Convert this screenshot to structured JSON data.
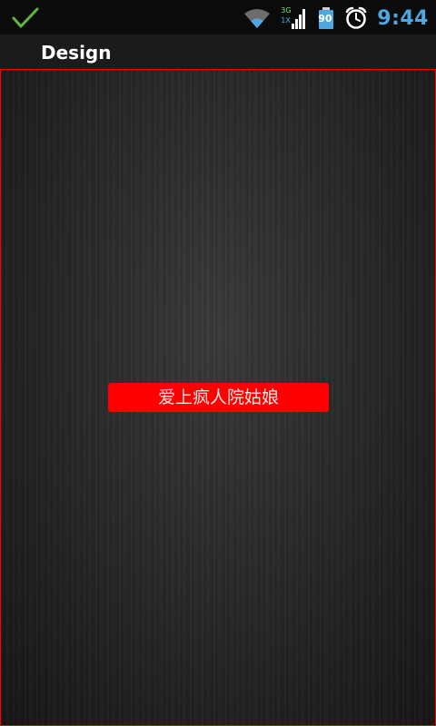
{
  "status_bar": {
    "time": "9:44",
    "battery_level": "90",
    "network_3g": "3G",
    "network_1x": "1X",
    "icons": [
      "checkmark-icon",
      "wifi-icon",
      "signal-icon",
      "battery-icon",
      "alarm-clock-icon"
    ],
    "time_color": "#4ea7df"
  },
  "title_bar": {
    "title": "Design"
  },
  "content": {
    "label": "爱上疯人院姑娘",
    "label_background": "#ff0000",
    "border_color": "#ff0000"
  }
}
